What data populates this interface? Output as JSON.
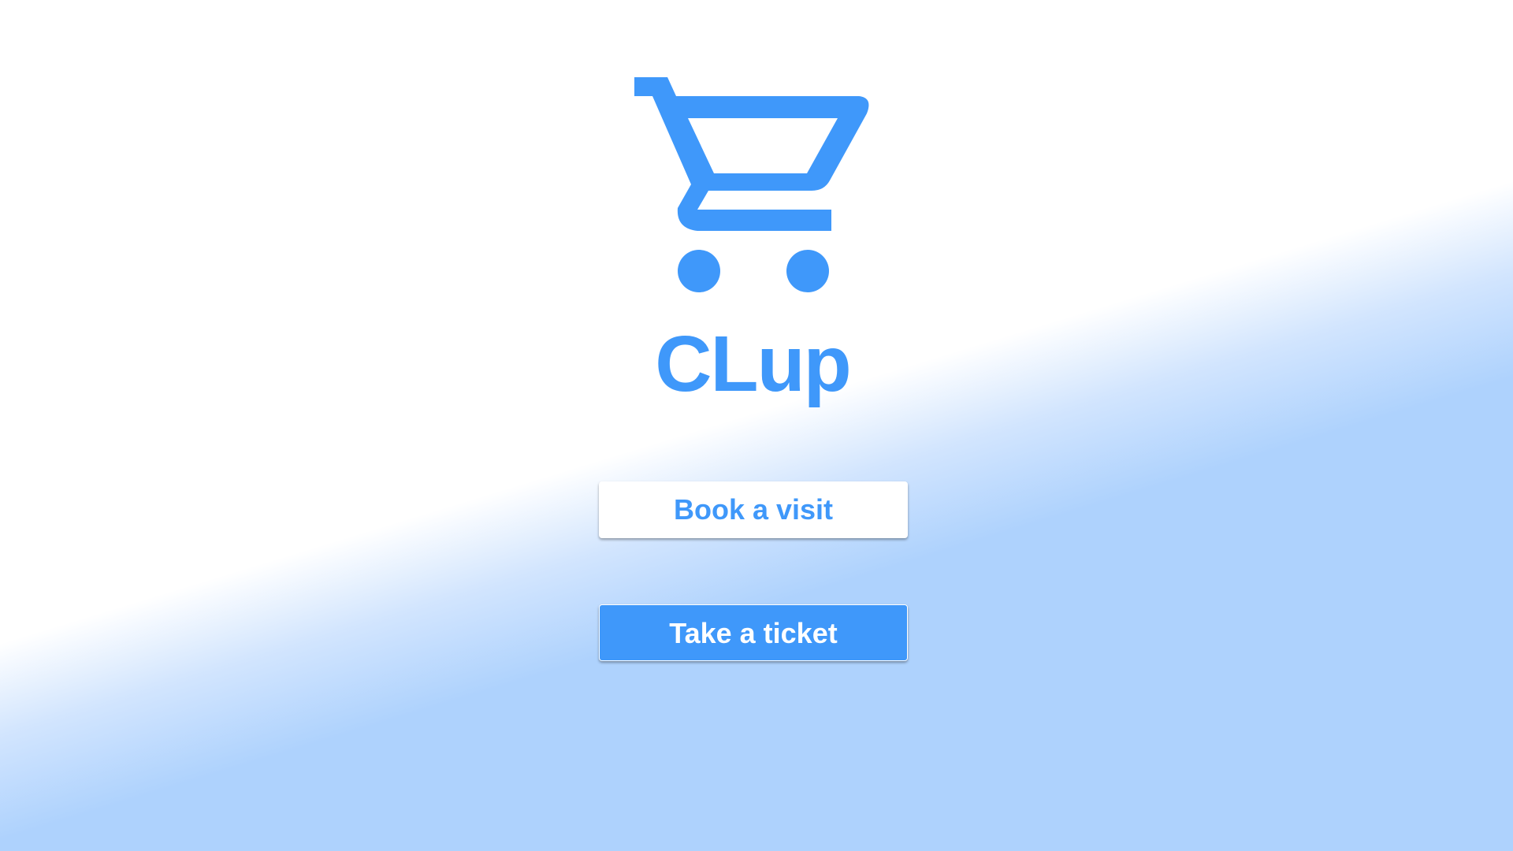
{
  "app": {
    "title": "CLup",
    "logo_icon": "shopping-cart-icon",
    "accent_color": "#3f98fa",
    "background_color": "#aed2fd"
  },
  "actions": {
    "book_label": "Book a visit",
    "ticket_label": "Take a ticket"
  }
}
